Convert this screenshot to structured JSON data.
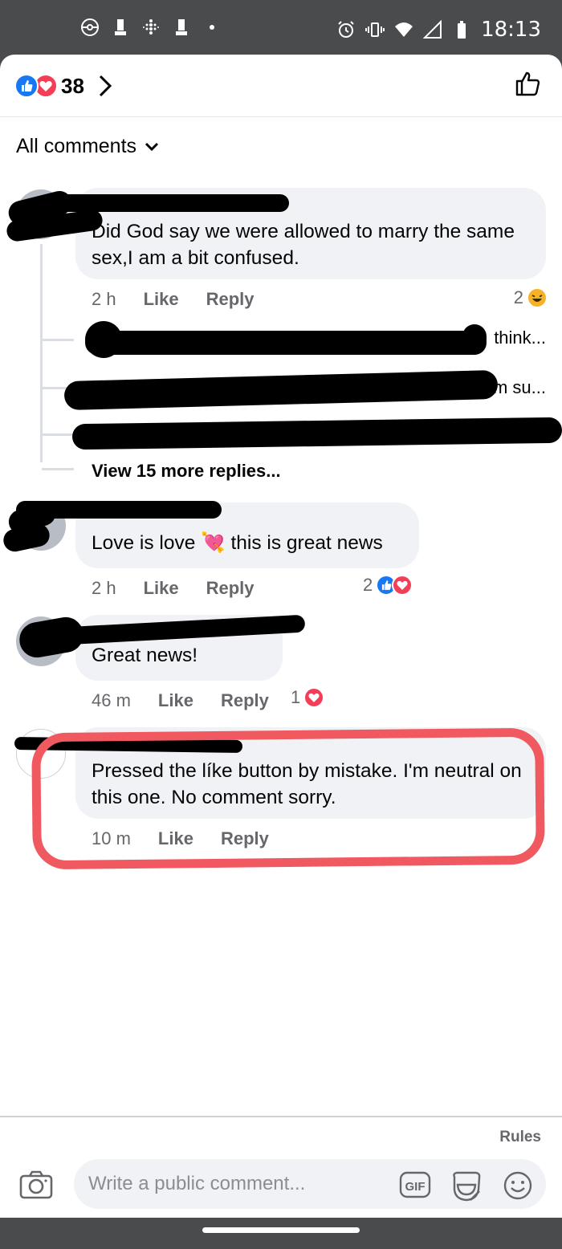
{
  "status_bar": {
    "time": "18:13"
  },
  "header": {
    "reaction_count": "38",
    "reactions": [
      "like-icon",
      "love-icon"
    ]
  },
  "filter": {
    "label": "All comments"
  },
  "comments": [
    {
      "author": "",
      "text": "Did God say we were allowed to marry the same sex,I am a bit confused.",
      "time": "2 h",
      "like": "Like",
      "reply": "Reply",
      "reaction_count": "2",
      "reactions": [
        "haha-icon"
      ]
    },
    {
      "author": "",
      "text": "Love is love 💘 this is great news",
      "time": "2 h",
      "like": "Like",
      "reply": "Reply",
      "reaction_count": "2",
      "reactions": [
        "like-icon",
        "love-icon"
      ]
    },
    {
      "author": "",
      "text": "Great news!",
      "time": "46 m",
      "like": "Like",
      "reply": "Reply",
      "reaction_count": "1",
      "reactions": [
        "love-icon"
      ]
    },
    {
      "author": "",
      "text": "Pressed the líke button by mistake. I'm neutral on this one. No comment sorry.",
      "time": "10 m",
      "like": "Like",
      "reply": "Reply"
    }
  ],
  "replies": [
    {
      "preview": "think..."
    },
    {
      "preview": "I'm su..."
    },
    {
      "preview": ""
    }
  ],
  "view_more": "View 15 more replies...",
  "composer": {
    "rules": "Rules",
    "placeholder": "Write a public comment...",
    "gif": "GIF"
  },
  "colors": {
    "like_blue": "#1877f2",
    "love_red": "#f33e58",
    "haha_yellow": "#f7b125",
    "highlight": "#f0595f"
  }
}
